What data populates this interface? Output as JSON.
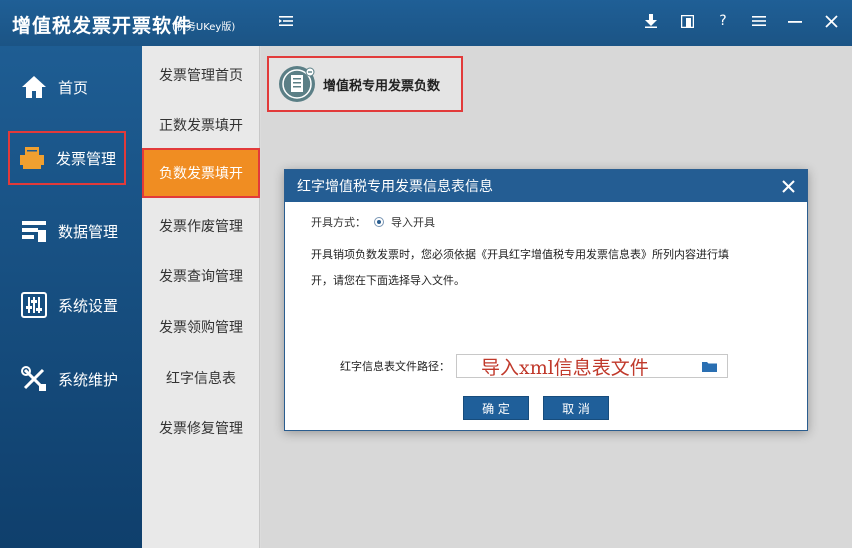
{
  "app": {
    "title": "增值税发票开票软件",
    "subtitle": "(税务UKey版)"
  },
  "titlebar_icons": [
    "download-icon",
    "bookmark-icon",
    "help-icon",
    "menu-icon",
    "minimize-icon",
    "close-icon"
  ],
  "titlebar_glyphs": {
    "help": "?"
  },
  "left_nav": [
    {
      "label": "首页",
      "icon": "home-icon"
    },
    {
      "label": "发票管理",
      "icon": "printer-icon"
    },
    {
      "label": "数据管理",
      "icon": "data-icon"
    },
    {
      "label": "系统设置",
      "icon": "sliders-icon"
    },
    {
      "label": "系统维护",
      "icon": "tools-icon"
    }
  ],
  "sub_nav": [
    {
      "label": "发票管理首页"
    },
    {
      "label": "正数发票填开"
    },
    {
      "label": "负数发票填开"
    },
    {
      "label": "发票作废管理"
    },
    {
      "label": "发票查询管理"
    },
    {
      "label": "发票领购管理"
    },
    {
      "label": "红字信息表"
    },
    {
      "label": "发票修复管理"
    }
  ],
  "function_card": {
    "label": "增值税专用发票负数",
    "icon": "invoice-stamp-icon"
  },
  "dialog": {
    "title": "红字增值税专用发票信息表信息",
    "mode_label": "开具方式：",
    "mode_option": "导入开具",
    "note_line1": "开具销项负数发票时，您必须依据《开具红字增值税专用发票信息表》所列内容进行填",
    "note_line2": "开，请您在下面选择导入文件。",
    "path_label": "红字信息表文件路径：",
    "path_placeholder": "导入xml信息表文件",
    "confirm_label": "确 定",
    "cancel_label": "取 消"
  },
  "colors": {
    "titlebar": "#1f5f96",
    "active_subnav": "#f08d22",
    "highlight_border": "#e23a3a",
    "button": "#1f5f9a"
  }
}
